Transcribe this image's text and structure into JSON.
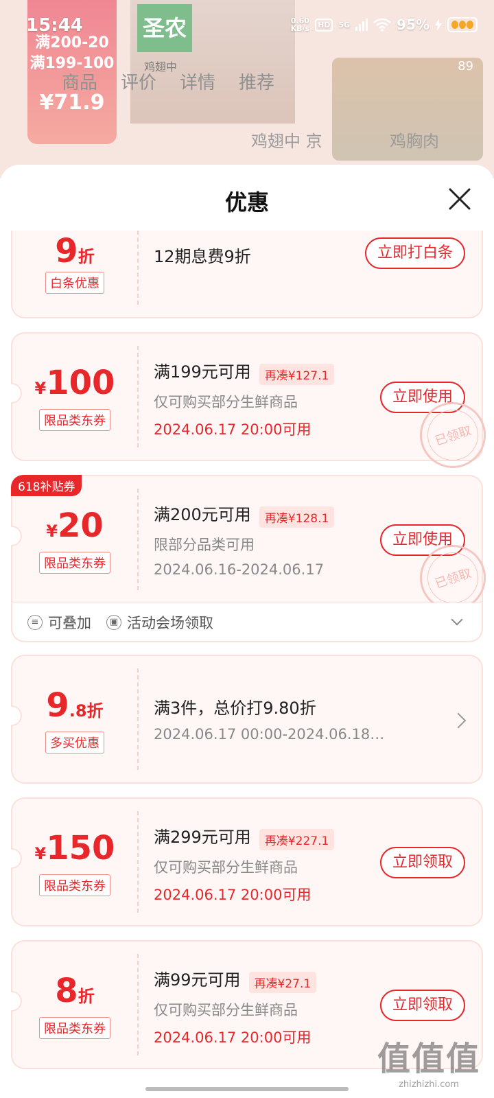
{
  "status_bar": {
    "time": "15:44",
    "net_speed_value": "0.60",
    "net_speed_unit": "KB/s",
    "hd": "HD",
    "network": "5G",
    "battery_percent": "95%"
  },
  "background": {
    "tabs": [
      "商品",
      "评价",
      "详情",
      "推荐"
    ],
    "promo_line1": "满200-20",
    "promo_line2": "满199-100",
    "promo_price": "¥71.9",
    "brand": "圣农",
    "bag_label": "鸡翅中",
    "count": "89",
    "related": [
      "鸡翅中 京",
      "鸡胸肉"
    ]
  },
  "sheet": {
    "title": "优惠"
  },
  "coupons": [
    {
      "amount_main": "9",
      "amount_suffix": "折",
      "tag": "白条优惠",
      "title": "12期息费9折",
      "button": "立即打白条"
    },
    {
      "amount_prefix": "¥",
      "amount_main": "100",
      "tag": "限品类东券",
      "title": "满199元可用",
      "need": "再凑¥127.1",
      "desc": "仅可购买部分生鲜商品",
      "date": "2024.06.17 20:00可用",
      "button": "立即使用",
      "stamp": "已领取"
    },
    {
      "badge": "618补贴券",
      "amount_prefix": "¥",
      "amount_main": "20",
      "tag": "限品类东券",
      "title": "满200元可用",
      "need": "再凑¥128.1",
      "desc": "限部分品类可用",
      "date": "2024.06.16-2024.06.17",
      "button": "立即使用",
      "stamp": "已领取",
      "footer_stack": "可叠加",
      "footer_source": "活动会场领取"
    },
    {
      "amount_main": "9",
      "amount_decimal": ".8",
      "amount_suffix": "折",
      "tag": "多买优惠",
      "title": "满3件，总价打9.80折",
      "date": "2024.06.17 00:00-2024.06.18…"
    },
    {
      "amount_prefix": "¥",
      "amount_main": "150",
      "tag": "限品类东券",
      "title": "满299元可用",
      "need": "再凑¥227.1",
      "desc": "仅可购买部分生鲜商品",
      "date": "2024.06.17 20:00可用",
      "button": "立即领取"
    },
    {
      "amount_main": "8",
      "amount_suffix": "折",
      "tag": "限品类东券",
      "title": "满99元可用",
      "need": "再凑¥27.1",
      "desc": "仅可购买部分生鲜商品",
      "date": "2024.06.17 20:00可用",
      "button": "立即领取"
    }
  ],
  "watermark": {
    "big": "值值值",
    "small": "zhizhizhi.com"
  },
  "colors": {
    "accent": "#e8272b",
    "card_bg": "#fff7f6",
    "card_border": "#fbe0dc"
  }
}
